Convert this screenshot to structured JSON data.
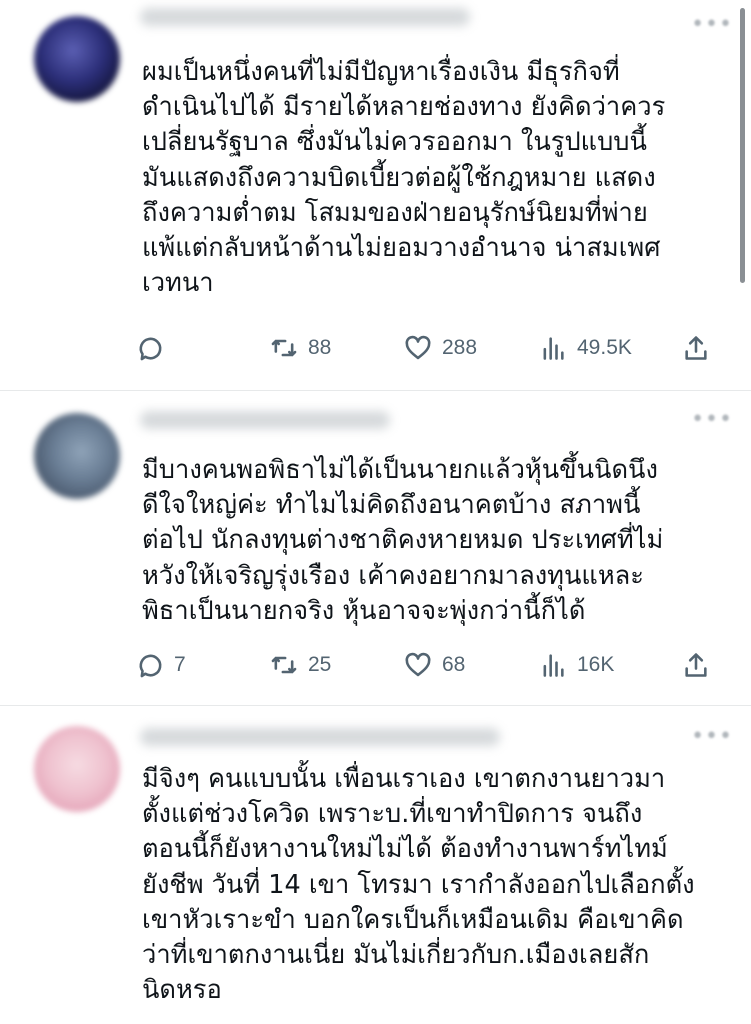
{
  "tweets": [
    {
      "text": "ผมเป็นหนึ่งคนที่ไม่มีปัญหาเรื่องเงิน มีธุรกิจที่\nดำเนินไปได้ มีรายได้หลายช่องทาง ยังคิดว่าควร\nเปลี่ยนรัฐบาล ซึ่งมันไม่ควรออกมา ในรูปแบบนี้\nมันแสดงถึงความบิดเบี้ยวต่อผู้ใช้กฎหมาย แสดง\nถึงความต่ำตม โสมมของฝ่ายอนุรักษ์นิยมที่พ่าย\nแพ้แต่กลับหน้าด้านไม่ยอมวางอำนาจ น่าสมเพศ\nเวทนา",
      "replies": "",
      "retweets": "88",
      "likes": "288",
      "views": "49.5K"
    },
    {
      "text": "มีบางคนพอพิธาไม่ได้เป็นนายกแล้วหุ้นขึ้นนิดนึง\nดีใจใหญ่ค่ะ   ทำไมไม่คิดถึงอนาคตบ้าง สภาพนี้\nต่อไป นักลงทุนต่างชาติคงหายหมด ประเทศที่ไม่\nหวังให้เจริญรุ่งเรือง เค้าคงอยากมาลงทุนแหละ\nพิธาเป็นนายกจริง หุ้นอาจจะพุ่งกว่านี้ก็ได้",
      "replies": "7",
      "retweets": "25",
      "likes": "68",
      "views": "16K"
    },
    {
      "text": "มีจิงๆ คนแบบนั้น เพื่อนเราเอง เขาตกงานยาวมา\nตั้งแต่ช่วงโควิด เพราะบ.ที่เขาทำปิดการ จนถึง\nตอนนี้ก็ยังหางานใหม่ไม่ได้ ต้องทำงานพาร์ทไทม์\nยังชีพ วันที่ 14 เขา โทรมา เรากำลังออกไปเลือกตั้ง\nเขาหัวเราะขำ บอกใครเป็นก็เหมือนเดิม คือเขาคิด\nว่าที่เขาตกงานเนี่ย มันไม่เกี่ยวกับก.เมืองเลยสัก\nนิดหรอ"
    }
  ],
  "icons": {
    "reply": "reply-icon",
    "retweet": "retweet-icon",
    "like": "heart-icon",
    "views": "views-icon",
    "share": "share-icon"
  },
  "colors": {
    "text": "#0f1419",
    "muted": "#536471",
    "divider": "#e7e9ea"
  }
}
